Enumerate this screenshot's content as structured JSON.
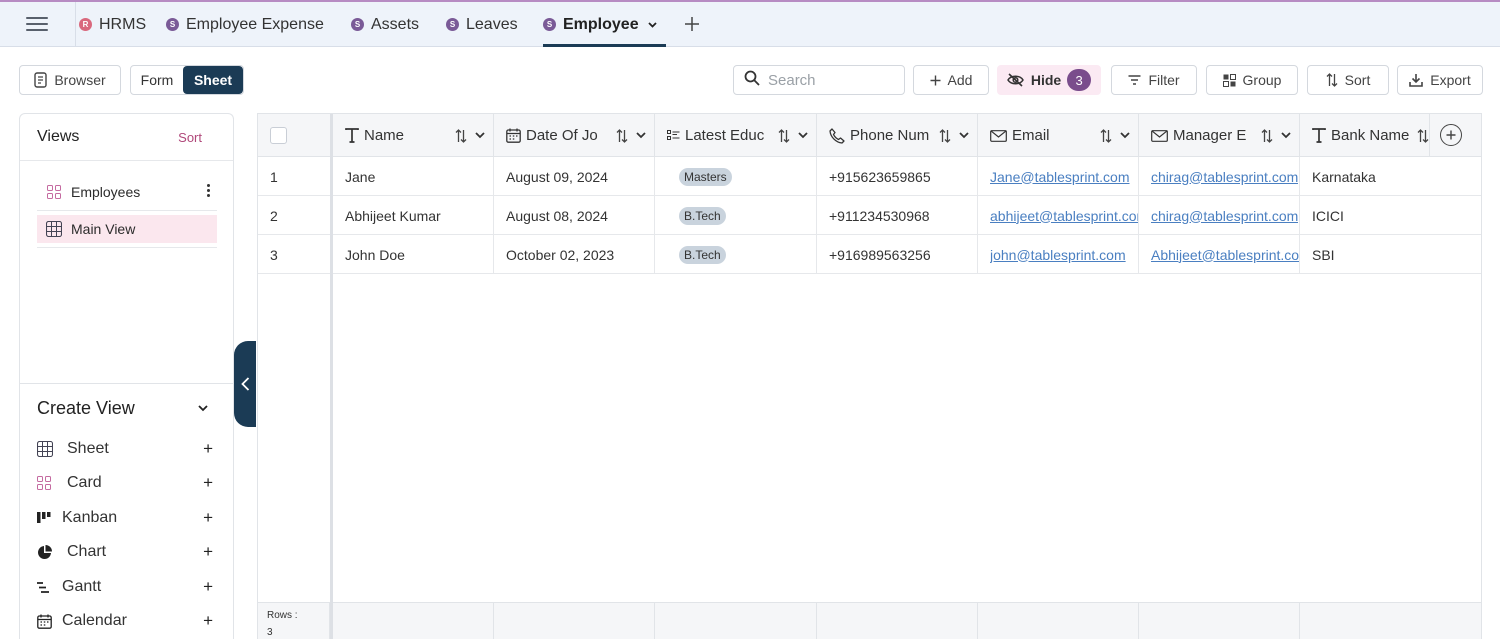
{
  "tabs": [
    {
      "label": "HRMS",
      "dot": "R",
      "dot_color": "#d9687d"
    },
    {
      "label": "Employee Expense",
      "dot": "S",
      "dot_color": "#7a5a97"
    },
    {
      "label": "Assets",
      "dot": "S",
      "dot_color": "#7a5a97"
    },
    {
      "label": "Leaves",
      "dot": "S",
      "dot_color": "#7a5a97"
    },
    {
      "label": "Employee",
      "dot": "S",
      "dot_color": "#7a5a97",
      "active": true
    }
  ],
  "toolbar": {
    "browser": "Browser",
    "form": "Form",
    "sheet": "Sheet",
    "search_placeholder": "Search",
    "add": "Add",
    "hide": "Hide",
    "hide_count": "3",
    "filter": "Filter",
    "group": "Group",
    "sort": "Sort",
    "export": "Export"
  },
  "sidebar": {
    "views_title": "Views",
    "views_sort": "Sort",
    "views": [
      {
        "label": "Employees",
        "icon": "card-grid-icon"
      },
      {
        "label": "Main View",
        "icon": "sheet-grid-icon",
        "active": true
      }
    ],
    "create_title": "Create View",
    "create_items": [
      {
        "label": "Sheet",
        "icon": "sheet-grid-icon"
      },
      {
        "label": "Card",
        "icon": "card-grid-icon"
      },
      {
        "label": "Kanban",
        "icon": "kanban-icon"
      },
      {
        "label": "Chart",
        "icon": "pie-chart-icon"
      },
      {
        "label": "Gantt",
        "icon": "gantt-icon"
      },
      {
        "label": "Calendar",
        "icon": "calendar-icon"
      }
    ]
  },
  "grid": {
    "columns": [
      {
        "label": "Name",
        "icon": "text-type-icon"
      },
      {
        "label": "Date Of Jo",
        "icon": "calendar-icon"
      },
      {
        "label": "Latest Educ",
        "icon": "list-select-icon"
      },
      {
        "label": "Phone Num",
        "icon": "phone-icon"
      },
      {
        "label": "Email",
        "icon": "mail-icon"
      },
      {
        "label": "Manager E",
        "icon": "mail-icon"
      },
      {
        "label": "Bank Name",
        "icon": "text-type-icon"
      }
    ],
    "rows": [
      {
        "num": "1",
        "name": "Jane",
        "doj": "August 09, 2024",
        "edu": "Masters",
        "phone": "+915623659865",
        "email": "Jane@tablesprint.com",
        "manager": "chirag@tablesprint.com",
        "bank": "Karnataka"
      },
      {
        "num": "2",
        "name": "Abhijeet Kumar",
        "doj": "August 08, 2024",
        "edu": "B.Tech",
        "phone": "+911234530968",
        "email": "abhijeet@tablesprint.com",
        "manager": "chirag@tablesprint.com",
        "bank": "ICICI"
      },
      {
        "num": "3",
        "name": "John Doe",
        "doj": "October 02, 2023",
        "edu": "B.Tech",
        "phone": "+916989563256",
        "email": "john@tablesprint.com",
        "manager": "Abhijeet@tablesprint.com",
        "bank": "SBI"
      }
    ],
    "rows_label": "Rows :",
    "rows_count": "3"
  },
  "colors": {
    "accent": "#1b3b55",
    "brand_pink": "#b0487a",
    "hide_badge": "#7a4d8c"
  }
}
